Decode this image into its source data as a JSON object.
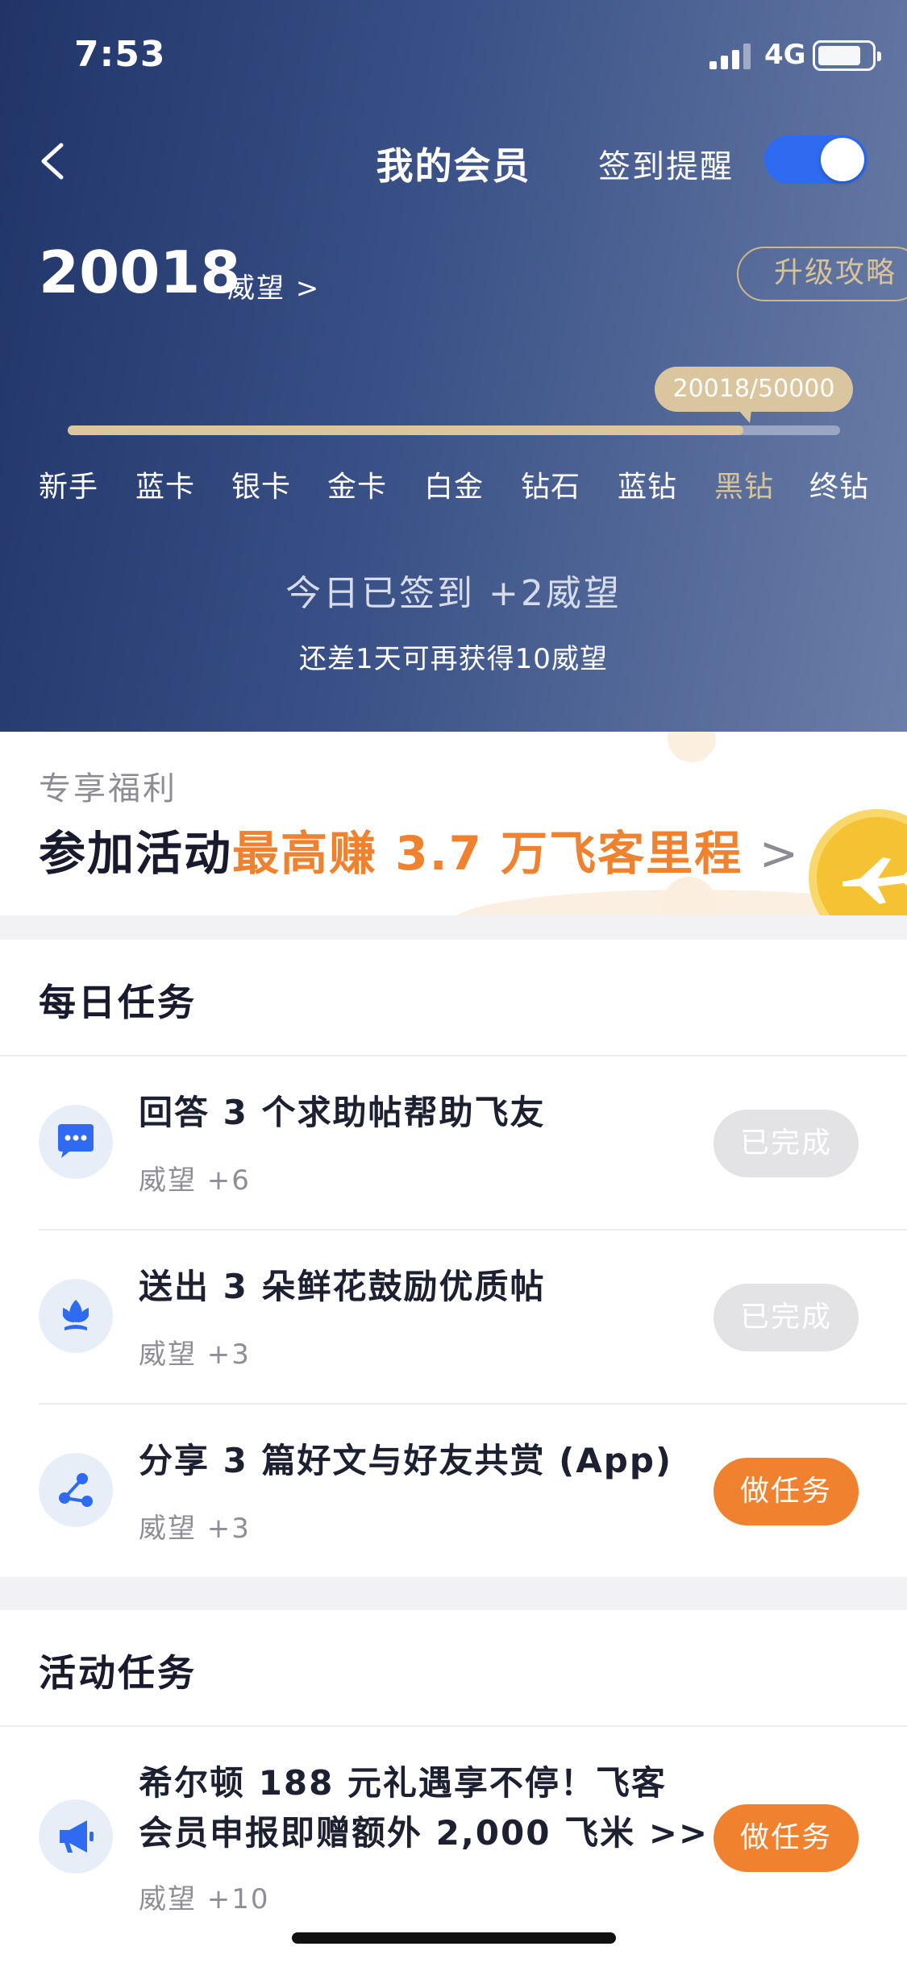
{
  "status_bar": {
    "time": "7:53",
    "network": "4G"
  },
  "nav": {
    "title": "我的会员",
    "remind_label": "签到提醒",
    "remind_on": true
  },
  "membership": {
    "points": "20018",
    "points_unit": "威望 >",
    "upgrade_label": "升级攻略",
    "progress_text": "20018/50000",
    "progress_fraction": 0.875,
    "levels": [
      "新手",
      "蓝卡",
      "银卡",
      "金卡",
      "白金",
      "钻石",
      "蓝钻",
      "黑钻",
      "终钻"
    ],
    "current_level": "黑钻",
    "signed_text": "今日已签到 +2威望",
    "need_text": "还差1天可再获得10威望"
  },
  "benefit": {
    "label": "专享福利",
    "prefix": "参加活动",
    "highlight": "最高赚 3.7 万飞客里程",
    "arrow": " >"
  },
  "daily": {
    "title": "每日任务",
    "tasks": [
      {
        "icon": "chat-bubble-icon",
        "title": "回答 3 个求助帖帮助飞友",
        "reward": "威望 +6",
        "button": "已完成",
        "state": "done"
      },
      {
        "icon": "flower-icon",
        "title": "送出 3 朵鲜花鼓励优质帖",
        "reward": "威望 +3",
        "button": "已完成",
        "state": "done"
      },
      {
        "icon": "share-icon",
        "title": "分享 3 篇好文与好友共赏 (App)",
        "reward": "威望 +3",
        "button": "做任务",
        "state": "todo"
      }
    ]
  },
  "activity": {
    "title": "活动任务",
    "tasks": [
      {
        "icon": "megaphone-icon",
        "title_line1": "希尔顿 188 元礼遇享不停！飞客",
        "title_line2": "会员申报即赠额外 2,000 飞米 >>",
        "reward": "威望 +10",
        "button": "做任务",
        "state": "todo"
      }
    ]
  },
  "colors": {
    "accent_orange": "#f0812e",
    "toggle_blue": "#2f6bf0",
    "gold": "#d9c69e",
    "header_dark": "#203468"
  }
}
